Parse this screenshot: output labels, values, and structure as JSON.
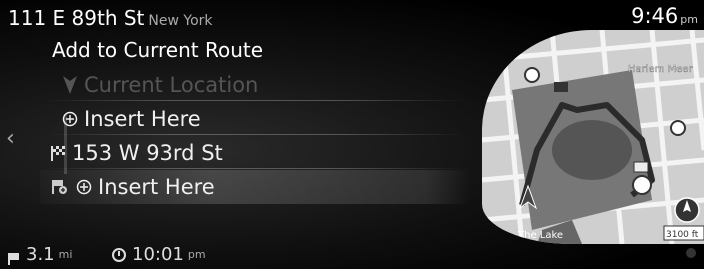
{
  "topbar": {
    "address": "111 E 89th St",
    "city": "New York",
    "time": "9:46",
    "ampm": "pm"
  },
  "list": {
    "heading": "Add to Current Route",
    "rows": [
      {
        "label": "Current Location",
        "icon": "origin-arrow-icon"
      },
      {
        "label": "Insert Here",
        "icon": "circle-plus-icon"
      },
      {
        "label": "153 W 93rd St",
        "icon": "checkered-flag-icon"
      },
      {
        "label": "Insert Here",
        "icon": "circle-plus-icon"
      }
    ]
  },
  "map": {
    "labels": {
      "top_right": "Harlem Meer",
      "bottom": "The Lake",
      "scale": "3100 ft"
    }
  },
  "bottombar": {
    "distance": "3.1",
    "distance_unit": "mi",
    "eta": "10:01",
    "eta_unit": "pm"
  },
  "colors": {
    "background": "#000000",
    "text": "#ffffff",
    "dim_text": "#555555",
    "map_route": "#333333",
    "park": "#6a6a6a"
  }
}
